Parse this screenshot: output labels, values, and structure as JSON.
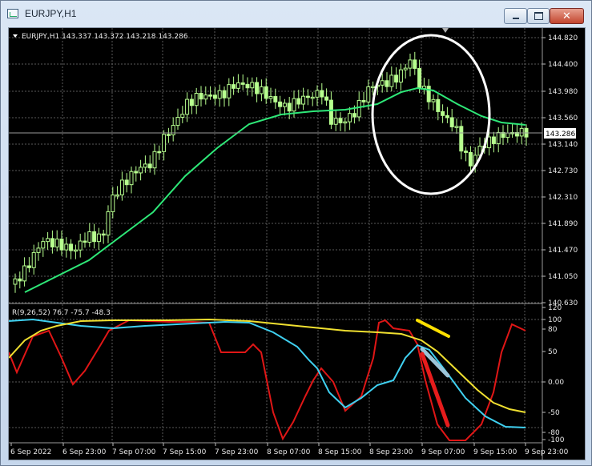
{
  "window": {
    "title": "EURJPY,H1",
    "controls": {
      "minimize": "minimize",
      "maximize": "maximize",
      "close": "✕"
    }
  },
  "chart": {
    "info_line": "EURJPY,H1  143.337 143.372 143.218 143.286",
    "price_ticks": [
      "144.820",
      "144.400",
      "143.980",
      "143.560",
      "143.140",
      "142.730",
      "142.310",
      "141.890",
      "141.470",
      "141.050",
      "140.630"
    ],
    "current_price_label": "143.286",
    "indicator_label": "R(9,26,52) 76.7 -75.7 -48.3",
    "indicator_ticks": [
      "120",
      "100",
      "80",
      "50",
      "0.00",
      "-50",
      "-80",
      "-100"
    ],
    "time_labels": [
      "6 Sep 2022",
      "6 Sep 23:00",
      "7 Sep 07:00",
      "7 Sep 15:00",
      "7 Sep 23:00",
      "8 Sep 07:00",
      "8 Sep 15:00",
      "8 Sep 23:00",
      "9 Sep 07:00",
      "9 Sep 15:00",
      "9 Sep 23:00"
    ],
    "colors": {
      "background": "#000000",
      "grid": "#5a5a5a",
      "bull_candle": "#b7ff8f",
      "moving_average": "#2ee878",
      "rsi_fast": "#e01616",
      "rsi_mid": "#3fd0f0",
      "rsi_slow": "#f0e030",
      "annotation_circle": "#ffffff",
      "trend_yellow": "#ffe000",
      "trend_blue": "#9cc4d8",
      "trend_red": "#e61c1c"
    }
  }
}
